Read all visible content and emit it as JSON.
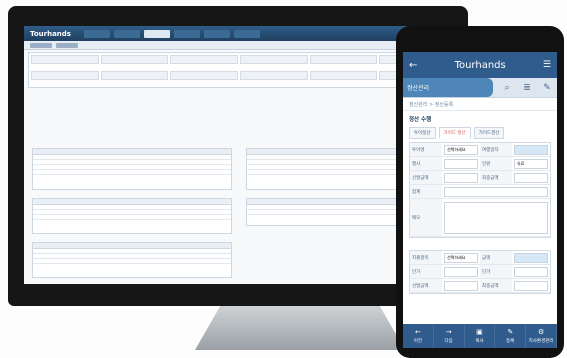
{
  "desktop": {
    "logo": "Tourhands"
  },
  "phone": {
    "title": "Tourhands",
    "app_tab": "정산관리",
    "breadcrumb": "정산관리 > 정산등록",
    "section_title": "정산 수행",
    "tabs": [
      "투어정산",
      "가이드 정산",
      "가이드결산"
    ],
    "fields": [
      {
        "label": "투어명",
        "value": "선택하세요",
        "label2": "여행일자",
        "value2": ""
      },
      {
        "label": "행사",
        "value": "",
        "label2": "인원",
        "value2": "유료"
      },
      {
        "label": "선발금액",
        "value": "",
        "label2": "최종금액",
        "value2": ""
      },
      {
        "label": "합계",
        "value": "",
        "label2": "",
        "value2": ""
      },
      {
        "label": "메모",
        "value": "",
        "label2": "",
        "value2": ""
      }
    ],
    "fields2": [
      {
        "label": "지출항목",
        "value": "선택하세요",
        "label2": "금액",
        "value2": ""
      },
      {
        "label": "단가",
        "value": "",
        "label2": "단가",
        "value2": ""
      },
      {
        "label": "선발금액",
        "value": "",
        "label2": "최종금액",
        "value2": ""
      }
    ],
    "bottom": [
      {
        "icon": "←",
        "label": "이전"
      },
      {
        "icon": "→",
        "label": "다음"
      },
      {
        "icon": "▣",
        "label": "복사"
      },
      {
        "icon": "✎",
        "label": "등록"
      },
      {
        "icon": "⚙",
        "label": "지사환경관리"
      }
    ]
  }
}
